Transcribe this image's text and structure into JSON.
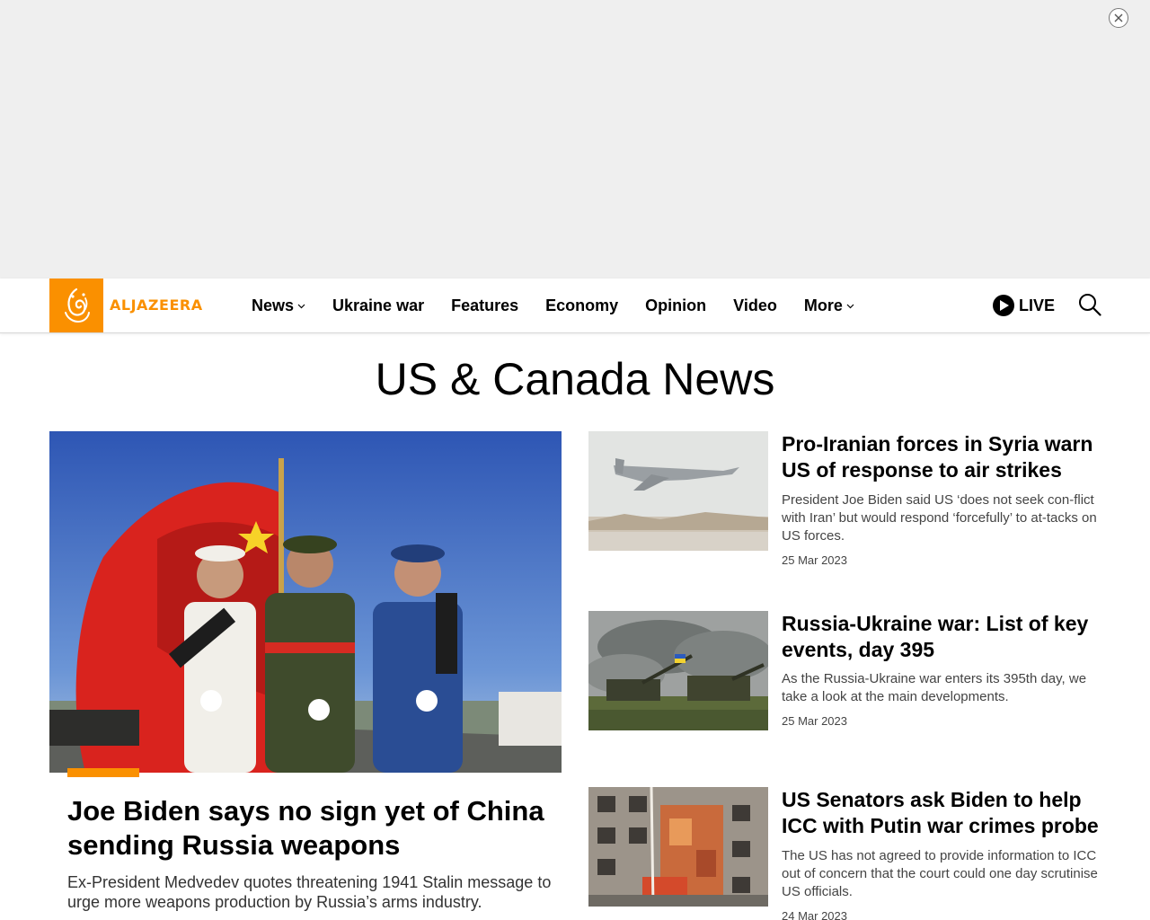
{
  "ad": {
    "close_icon": "close-circle-icon"
  },
  "header": {
    "logo_text": "ALJAZEERA",
    "brand_color": "#fa9000",
    "nav": [
      {
        "label": "News",
        "dropdown": true
      },
      {
        "label": "Ukraine war",
        "dropdown": false
      },
      {
        "label": "Features",
        "dropdown": false
      },
      {
        "label": "Economy",
        "dropdown": false
      },
      {
        "label": "Opinion",
        "dropdown": false
      },
      {
        "label": "Video",
        "dropdown": false
      },
      {
        "label": "More",
        "dropdown": true
      }
    ],
    "live_label": "LIVE",
    "search_icon": "search-icon"
  },
  "page": {
    "title": "US & Canada News"
  },
  "lead": {
    "title": "Joe Biden says no sign yet of China sending Russia weapons",
    "description": "Ex-President Medvedev quotes threatening 1941 Stalin message to urge more weapons production by Russia’s arms industry."
  },
  "stories": [
    {
      "title": "Pro-Iranian forces in Syria warn US of response to air strikes",
      "description": "President Joe Biden said US ‘does not seek con-flict with Iran’ but would respond ‘forcefully’ to at-tacks on US forces.",
      "date": "25 Mar 2023"
    },
    {
      "title": "Russia-Ukraine war: List of key events, day 395",
      "description": "As the Russia-Ukraine war enters its 395th day, we take a look at the main developments.",
      "date": "25 Mar 2023"
    },
    {
      "title": "US Senators ask Biden to help ICC with Putin war crimes probe",
      "description": "The US has not agreed to provide information to ICC out of concern that the court could one day scrutinise US officials.",
      "date": "24 Mar 2023"
    }
  ]
}
